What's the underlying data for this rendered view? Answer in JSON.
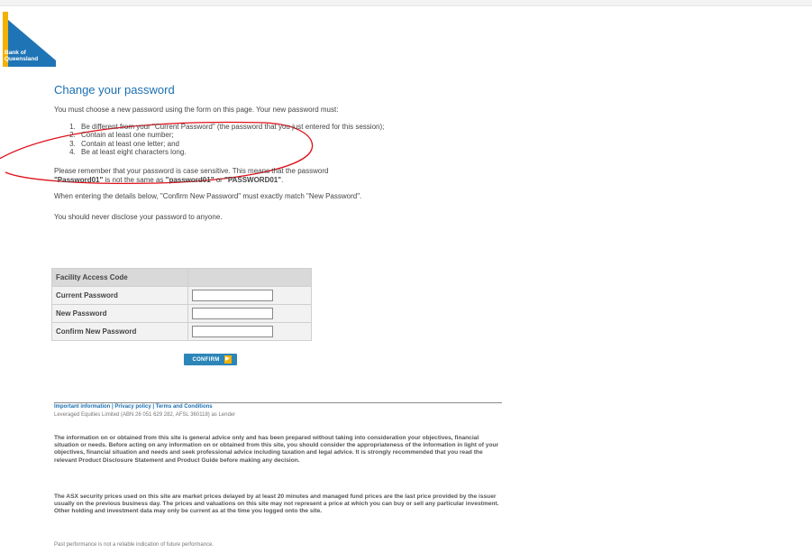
{
  "brand": {
    "logo_text_line1": "Bank of",
    "logo_text_line2": "Queensland",
    "colors": {
      "logo_blue": "#1f74b6",
      "logo_yellow": "#f3b100",
      "heading_blue": "#1a6fb0",
      "ellipse_red": "#e0101a"
    }
  },
  "page": {
    "title": "Change your password",
    "intro": "You must choose a new password using the form on this page. Your new password must:",
    "rules": [
      "Be different from your \"Current Password\" (the password that you just entered for this session);",
      "Contain at least one number;",
      "Contain at least one letter; and",
      "Be at least eight characters long."
    ],
    "case_note_prefix": "Please remember that your password is case sensitive. This means that the password",
    "case_example_1": "\"Password01\"",
    "case_note_middle": " is not the same as ",
    "case_example_2": "\"password01\"",
    "case_note_or": " or ",
    "case_example_3": "\"PASSWORD01\"",
    "case_note_end": ".",
    "confirm_note": "When entering the details below, \"Confirm New Password\" must exactly match \"New Password\".",
    "disclose_note": "You should never disclose your password to anyone."
  },
  "form": {
    "facility_access_code_label": "Facility Access Code",
    "current_password_label": "Current Password",
    "new_password_label": "New Password",
    "confirm_new_password_label": "Confirm New Password",
    "current_password_value": "",
    "new_password_value": "",
    "confirm_new_password_value": "",
    "confirm_button_label": "CONFIRM"
  },
  "footer": {
    "link_important": "Important information",
    "link_privacy": "Privacy policy",
    "link_terms": "Terms and Conditions",
    "separator": " | ",
    "lender": "Leveraged Equities Limited (ABN 26 051 629 282, AFSL 360118) as Lender",
    "disclaimer_1": "The information on or obtained from this site is general advice only and has been prepared without taking into consideration your objectives, financial situation or needs. Before acting on any information on or obtained from this site, you should consider the appropriateness of the information in light of your objectives, financial situation and needs and seek professional advice including taxation and legal advice. It is strongly recommended that you read the relevant Product Disclosure Statement and Product Guide before making any decision.",
    "disclaimer_2": "The ASX security prices used on this site are market prices delayed by at least 20 minutes and managed fund prices are the last price provided by the issuer usually on the previous business day. The prices and valuations on this site may not represent a price at which you can buy or sell any particular investment. Other holding and investment data may only be current as at the time you logged onto the site.",
    "past_performance": "Past performance is not a reliable indication of future performance."
  }
}
